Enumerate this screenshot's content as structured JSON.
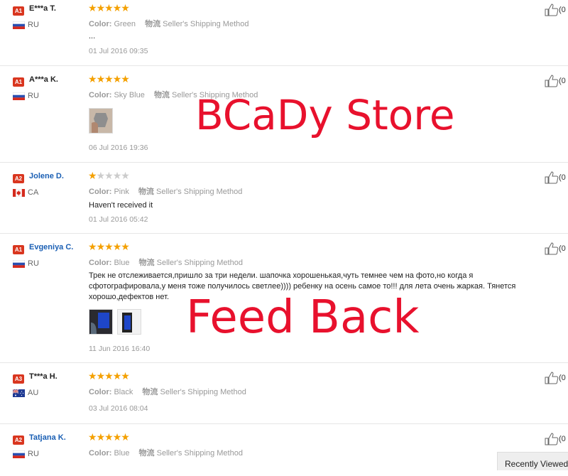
{
  "labels": {
    "color": "Color:",
    "logistics": "物流",
    "shipping": "Seller's Shipping Method"
  },
  "watermark": {
    "store": "BCaDy Store",
    "feedback": "Feed Back"
  },
  "recently_viewed": "Recently Viewed",
  "colors": {
    "badge_red": "#d9361f",
    "star": "#f4a000",
    "star_empty": "#cccccc",
    "link_blue": "#1a5fb4",
    "watermark_red": "#e8112d"
  },
  "reviews": [
    {
      "badge": "A1",
      "name": "E***a T.",
      "country": "RU",
      "flag": "ru-flag-icon",
      "rating": 5,
      "color_value": "Green",
      "text": "...",
      "date": "01 Jul 2016 09:35",
      "helpful": "(0"
    },
    {
      "badge": "A1",
      "name": "A***a K.",
      "country": "RU",
      "flag": "ru-flag-icon",
      "rating": 5,
      "color_value": "Sky Blue",
      "text": "",
      "date": "06 Jul 2016 19:36",
      "helpful": "(0"
    },
    {
      "badge": "A2",
      "name": "Jolene D.",
      "country": "CA",
      "flag": "ca-flag-icon",
      "rating": 1,
      "color_value": "Pink",
      "text": "Haven't received it",
      "date": "01 Jul 2016 05:42",
      "helpful": "(0"
    },
    {
      "badge": "A1",
      "name": "Evgeniya C.",
      "country": "RU",
      "flag": "ru-flag-icon",
      "rating": 5,
      "color_value": "Blue",
      "text": "Трек не отслеживается,пришло за три недели. шапочка хорошенькая,чуть темнее чем на фото,но когда я сфотографировала,у меня тоже получилось светлее)))) ребенку на осень самое то!!! для лета очень жаркая. Тянется хорошо,дефектов нет.",
      "date": "11 Jun 2016 16:40",
      "helpful": "(0"
    },
    {
      "badge": "A3",
      "name": "T***a H.",
      "country": "AU",
      "flag": "au-flag-icon",
      "rating": 5,
      "color_value": "Black",
      "text": "",
      "date": "03 Jul 2016 08:04",
      "helpful": "(0"
    },
    {
      "badge": "A2",
      "name": "Tatjana K.",
      "country": "RU",
      "flag": "ru-flag-icon",
      "rating": 5,
      "color_value": "Blue",
      "text": "",
      "date": "",
      "helpful": "(0"
    }
  ]
}
